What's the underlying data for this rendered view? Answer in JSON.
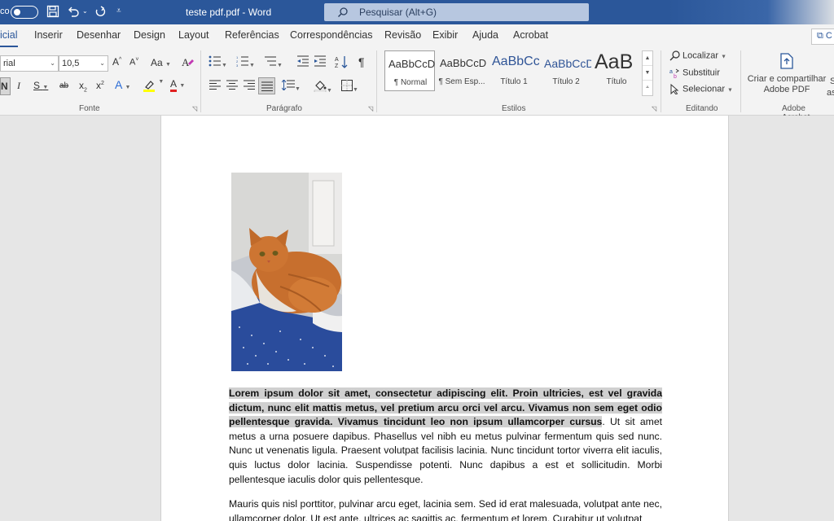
{
  "titlebar": {
    "autosave_label": "co",
    "document_title": "teste pdf.pdf",
    "separator": "-",
    "app_name": "Word",
    "search_placeholder": "Pesquisar (Alt+G)"
  },
  "tabs": [
    {
      "label": "icial",
      "active": true
    },
    {
      "label": "Inserir"
    },
    {
      "label": "Desenhar"
    },
    {
      "label": "Design"
    },
    {
      "label": "Layout"
    },
    {
      "label": "Referências"
    },
    {
      "label": "Correspondências"
    },
    {
      "label": "Revisão"
    },
    {
      "label": "Exibir"
    },
    {
      "label": "Ajuda"
    },
    {
      "label": "Acrobat"
    }
  ],
  "share_label": "C",
  "ribbon": {
    "font": {
      "font_name": "rial",
      "font_size": "10,5",
      "group_label": "Fonte",
      "case_label": "Aa",
      "bold_label": "N",
      "italic_label": "I",
      "underline_label": "S",
      "strike_label": "ab",
      "subscript_label": "x",
      "superscript_label": "x",
      "grow_label": "A",
      "shrink_label": "A",
      "effects_label": "A",
      "color_label": "A"
    },
    "paragraph": {
      "group_label": "Parágrafo",
      "pilcrow": "¶"
    },
    "styles": {
      "group_label": "Estilos",
      "items": [
        {
          "sample": "AaBbCcD",
          "name": "¶ Normal"
        },
        {
          "sample": "AaBbCcD",
          "name": "¶ Sem Esp..."
        },
        {
          "sample": "AaBbCc",
          "name": "Título 1"
        },
        {
          "sample": "AaBbCcD",
          "name": "Título 2"
        },
        {
          "sample": "AaB",
          "name": "Título"
        }
      ]
    },
    "editing": {
      "group_label": "Editando",
      "find": "Localizar",
      "replace": "Substituir",
      "select": "Selecionar"
    },
    "acrobat": {
      "group_label": "Adobe Acrobat",
      "create_share_line1": "Criar e compartilhar",
      "create_share_line2": "Adobe PDF",
      "cut_letter_1": "S",
      "cut_letter_2": "as"
    }
  },
  "document": {
    "paragraph1_bold": "Lorem ipsum dolor sit amet, consectetur adipiscing elit. Proin ultricies, est vel gravida dictum, nunc elit mattis metus, vel pretium arcu orci vel arcu. Vivamus non sem eget odio pellentesque gravida. Vivamus tincidunt leo non ipsum ullamcorper cursus",
    "paragraph1_rest": ". Ut sit amet metus a urna posuere dapibus. Phasellus vel nibh eu metus pulvinar fermentum quis sed nunc. Nunc ut venenatis ligula. Praesent volutpat facilisis lacinia. Nunc tincidunt tortor viverra elit iaculis, quis luctus dolor lacinia. Suspendisse potenti. Nunc dapibus a est et sollicitudin. Morbi pellentesque iaculis dolor quis pellentesque.",
    "paragraph2": "Mauris quis nisl porttitor, pulvinar arcu eget, lacinia sem. Sed id erat malesuada, volutpat ante nec, ullamcorper dolor. Ut est ante, ultrices ac sagittis ac, fermentum et lorem. Curabitur ut volutpat"
  },
  "colors": {
    "accent": "#2b579a",
    "highlight": "#d0d0d0"
  }
}
